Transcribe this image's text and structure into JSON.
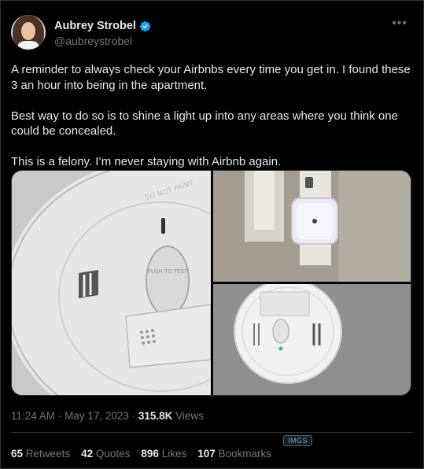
{
  "author": {
    "display_name": "Aubrey Strobel",
    "handle": "@aubreystrobel",
    "verified": true
  },
  "more_icon": "•••",
  "tweet": {
    "paragraphs": [
      "A reminder to always check your Airbnbs every time you get in. I found these 3 an hour into being in the apartment.",
      "Best way to do so is to shine a light up into any areas where you think one could be concealed.",
      "This is a felony. I’m never staying with Airbnb again."
    ]
  },
  "media": {
    "image1_text": "DO NOT PAINT",
    "image1_button_text": "PUSH TO TEST",
    "image3_button_text": ""
  },
  "meta": {
    "time": "11:24 AM",
    "date": "May 17, 2023",
    "views_count": "315.8K",
    "views_label": "Views"
  },
  "badge": "IMGS",
  "stats": {
    "retweets_count": "65",
    "retweets_label": "Retweets",
    "quotes_count": "42",
    "quotes_label": "Quotes",
    "likes_count": "896",
    "likes_label": "Likes",
    "bookmarks_count": "107",
    "bookmarks_label": "Bookmarks"
  },
  "colors": {
    "background": "#000000",
    "text_primary": "#e7e9ea",
    "text_secondary": "#71767b",
    "verified_blue": "#1d9bf0",
    "border": "#2f3336"
  }
}
